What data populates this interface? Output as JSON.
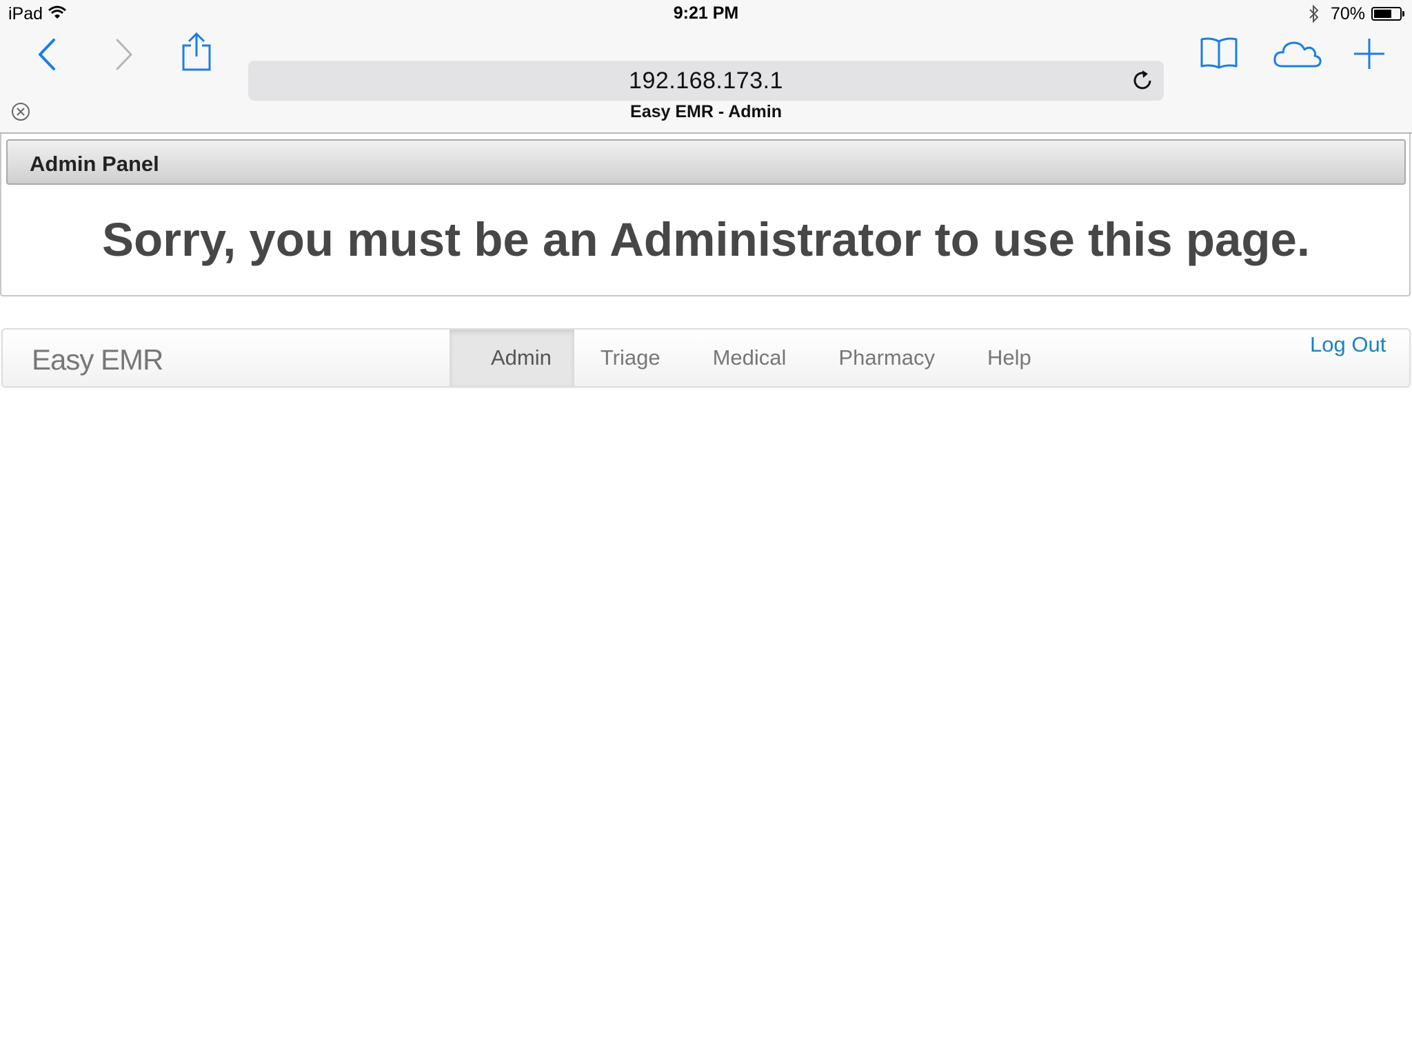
{
  "status_bar": {
    "device": "iPad",
    "time": "9:21 PM",
    "battery_percent": "70%",
    "battery_level": 0.7
  },
  "browser": {
    "url": "192.168.173.1",
    "tab_title": "Easy EMR - Admin",
    "accent_color": "#1a7ee6"
  },
  "panel": {
    "title": "Admin Panel",
    "message": "Sorry, you must be an Administrator to use this page."
  },
  "navbar": {
    "brand": "Easy EMR",
    "items": [
      {
        "label": "Admin",
        "active": true
      },
      {
        "label": "Triage",
        "active": false
      },
      {
        "label": "Medical",
        "active": false
      },
      {
        "label": "Pharmacy",
        "active": false
      },
      {
        "label": "Help",
        "active": false
      }
    ],
    "logout_label": "Log Out",
    "logout_color": "#1a82c6"
  }
}
